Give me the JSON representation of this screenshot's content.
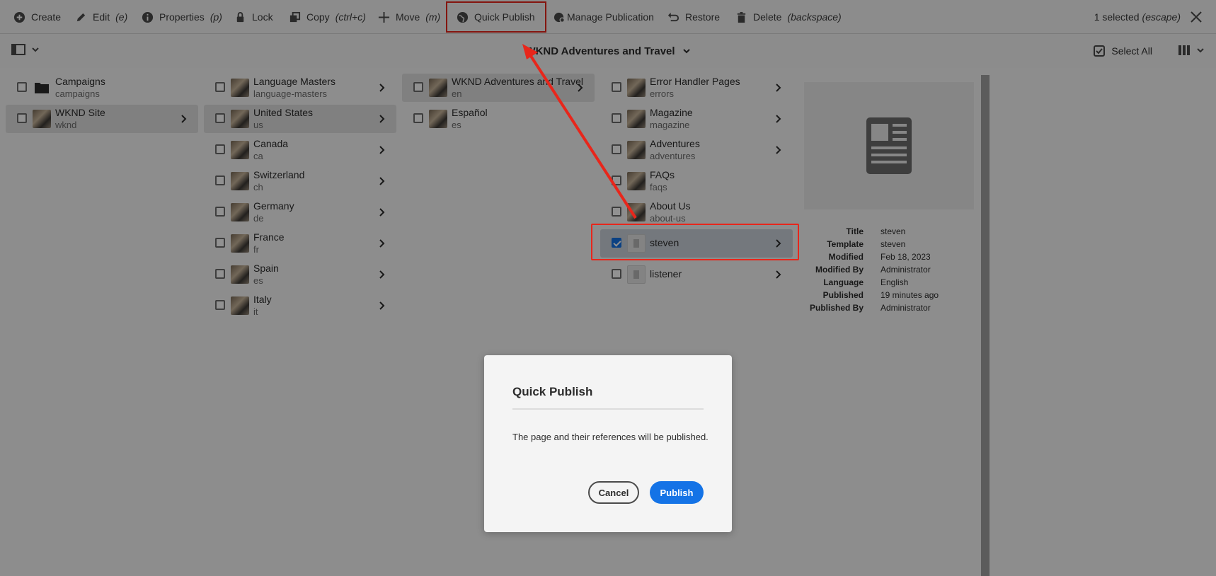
{
  "actionbar": {
    "create": "Create",
    "edit": "Edit",
    "edit_shortcut": "(e)",
    "properties": "Properties",
    "properties_shortcut": "(p)",
    "lock": "Lock",
    "copy": "Copy",
    "copy_shortcut": "(ctrl+c)",
    "move": "Move",
    "move_shortcut": "(m)",
    "quick_publish": "Quick Publish",
    "manage_publication": "Manage Publication",
    "restore": "Restore",
    "delete": "Delete",
    "delete_shortcut": "(backspace)",
    "selected": "1 selected",
    "selected_shortcut": "(escape)"
  },
  "subbar": {
    "title": "WKND Adventures and Travel",
    "select_all": "Select All"
  },
  "columns": {
    "col1": [
      {
        "title": "Campaigns",
        "sub": "campaigns"
      },
      {
        "title": "WKND Site",
        "sub": "wknd"
      }
    ],
    "col2": [
      {
        "title": "Language Masters",
        "sub": "language-masters"
      },
      {
        "title": "United States",
        "sub": "us"
      },
      {
        "title": "Canada",
        "sub": "ca"
      },
      {
        "title": "Switzerland",
        "sub": "ch"
      },
      {
        "title": "Germany",
        "sub": "de"
      },
      {
        "title": "France",
        "sub": "fr"
      },
      {
        "title": "Spain",
        "sub": "es"
      },
      {
        "title": "Italy",
        "sub": "it"
      }
    ],
    "col3": [
      {
        "title": "WKND Adventures and Travel",
        "sub": "en"
      },
      {
        "title": "Español",
        "sub": "es"
      }
    ],
    "col4": [
      {
        "title": "Error Handler Pages",
        "sub": "errors"
      },
      {
        "title": "Magazine",
        "sub": "magazine"
      },
      {
        "title": "Adventures",
        "sub": "adventures"
      },
      {
        "title": "FAQs",
        "sub": "faqs"
      },
      {
        "title": "About Us",
        "sub": "about-us"
      },
      {
        "title": "steven"
      },
      {
        "title": "listener"
      }
    ]
  },
  "meta": [
    {
      "k": "Title",
      "v": "steven"
    },
    {
      "k": "Template",
      "v": "steven"
    },
    {
      "k": "Modified",
      "v": "Feb 18, 2023"
    },
    {
      "k": "Modified By",
      "v": "Administrator"
    },
    {
      "k": "Language",
      "v": "English"
    },
    {
      "k": "Published",
      "v": "19 minutes ago"
    },
    {
      "k": "Published By",
      "v": "Administrator"
    }
  ],
  "dialog": {
    "title": "Quick Publish",
    "body": "The page and their references will be published.",
    "cancel": "Cancel",
    "publish": "Publish"
  },
  "colors": {
    "accent": "#1473e6",
    "highlight": "#e8261b"
  }
}
